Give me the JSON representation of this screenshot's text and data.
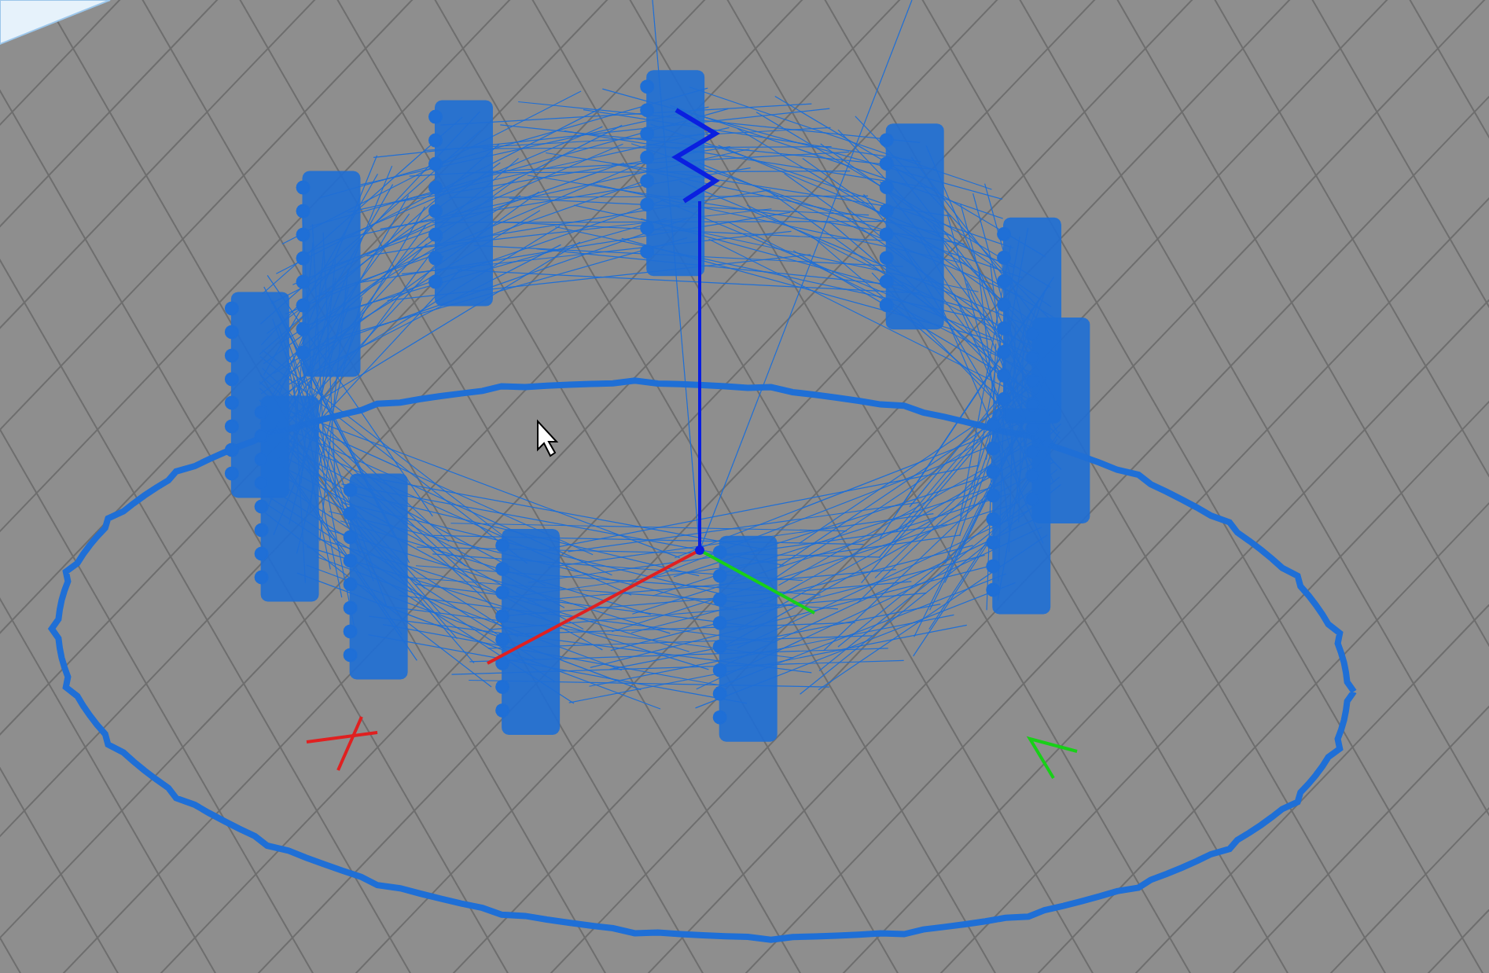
{
  "viewport": {
    "axes": true,
    "cursor": true
  }
}
